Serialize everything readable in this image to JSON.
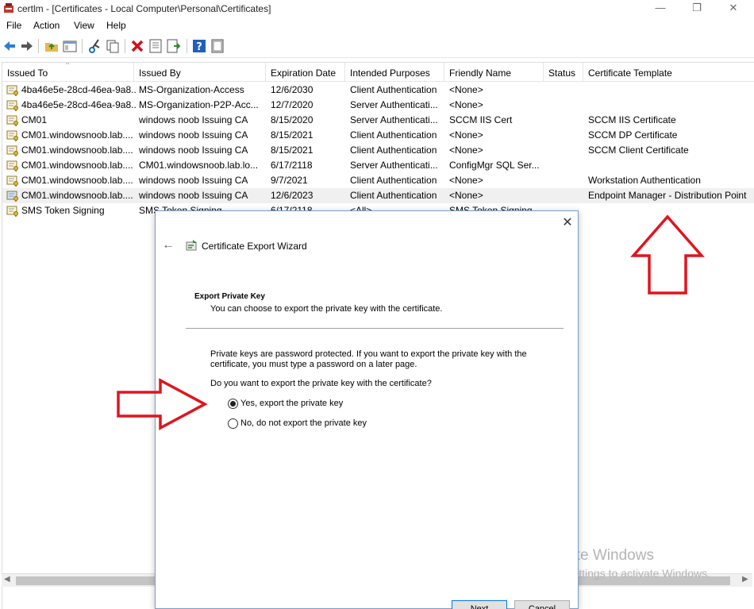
{
  "window": {
    "title": "certlm - [Certificates - Local Computer\\Personal\\Certificates]",
    "minimize_glyph": "—",
    "maximize_glyph": "❐",
    "close_glyph": "✕"
  },
  "menu": [
    "File",
    "Action",
    "View",
    "Help"
  ],
  "toolbar_icons": [
    "back-icon",
    "forward-icon",
    "up-folder-icon",
    "show-hide-tree-icon",
    "cut-icon",
    "copy-icon",
    "delete-icon",
    "properties-icon",
    "export-list-icon",
    "help-icon",
    "help-book-icon"
  ],
  "columns": [
    "Issued To",
    "Issued By",
    "Expiration Date",
    "Intended Purposes",
    "Friendly Name",
    "Status",
    "Certificate Template"
  ],
  "sort_glyph": "^",
  "rows": [
    [
      "4ba46e5e-28cd-46ea-9a8...",
      "MS-Organization-Access",
      "12/6/2030",
      "Client Authentication",
      "<None>",
      "",
      ""
    ],
    [
      "4ba46e5e-28cd-46ea-9a8...",
      "MS-Organization-P2P-Acc...",
      "12/7/2020",
      "Server Authenticati...",
      "<None>",
      "",
      ""
    ],
    [
      "CM01",
      "windows noob Issuing CA",
      "8/15/2020",
      "Server Authenticati...",
      "SCCM IIS Cert",
      "",
      "SCCM IIS Certificate"
    ],
    [
      "CM01.windowsnoob.lab....",
      "windows noob Issuing CA",
      "8/15/2021",
      "Client Authentication",
      "<None>",
      "",
      "SCCM DP Certificate"
    ],
    [
      "CM01.windowsnoob.lab....",
      "windows noob Issuing CA",
      "8/15/2021",
      "Client Authentication",
      "<None>",
      "",
      "SCCM Client Certificate"
    ],
    [
      "CM01.windowsnoob.lab....",
      "CM01.windowsnoob.lab.lo...",
      "6/17/2118",
      "Server Authenticati...",
      "ConfigMgr SQL Ser...",
      "",
      ""
    ],
    [
      "CM01.windowsnoob.lab....",
      "windows noob Issuing CA",
      "9/7/2021",
      "Client Authentication",
      "<None>",
      "",
      "Workstation Authentication"
    ],
    [
      "CM01.windowsnoob.lab....",
      "windows noob Issuing CA",
      "12/6/2023",
      "Client Authentication",
      "<None>",
      "",
      "Endpoint Manager - Distribution Point"
    ],
    [
      "SMS Token Signing",
      "SMS Token Signing",
      "6/17/2118",
      "<All>",
      "SMS Token Signing",
      "",
      ""
    ]
  ],
  "selected_row": 7,
  "dialog": {
    "close_glyph": "✕",
    "back_glyph": "←",
    "title": "Certificate Export Wizard",
    "heading": "Export Private Key",
    "subheading": "You can choose to export the private key with the certificate.",
    "description": "Private keys are password protected. If you want to export the private key with the certificate, you must type a password on a later page.",
    "question": "Do you want to export the private key with the certificate?",
    "option_yes": "Yes, export the private key",
    "option_no": "No, do not export the private key",
    "selected_option": "yes",
    "next_label": "Next",
    "cancel_label": "Cancel"
  },
  "watermark": {
    "line1": "Activate Windows",
    "line2": "Go to Settings to activate Windows."
  },
  "colors": {
    "annotation_arrow": "#e0141e",
    "watermark": "#b4b4b4",
    "selected_row": "#f0f0f0"
  }
}
